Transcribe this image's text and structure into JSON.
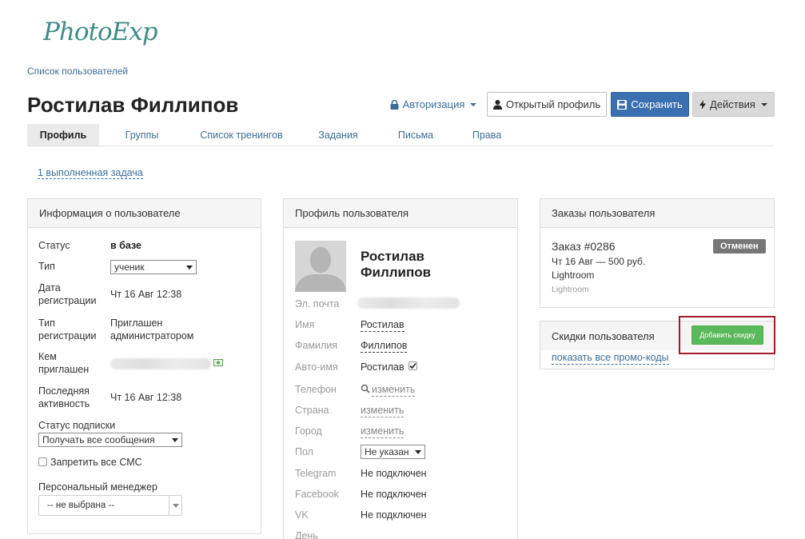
{
  "logo": "PhotoExp",
  "breadcrumb": "Список пользователей",
  "page_title": "Ростилав Филлипов",
  "header_buttons": {
    "auth": "Авторизация",
    "open_profile": "Открытый профиль",
    "save": "Сохранить",
    "actions": "Действия"
  },
  "tabs": [
    "Профиль",
    "Группы",
    "Список тренингов",
    "Задания",
    "Письма",
    "Права"
  ],
  "completed_tasks": "1 выполненная задача",
  "user_info": {
    "title": "Информация о пользователе",
    "status_label": "Статус",
    "status_value": "в базе",
    "type_label": "Тип",
    "type_value": "ученик",
    "reg_date_label_1": "Дата",
    "reg_date_label_2": "регистрации",
    "reg_date_value": "Чт 16 Авг 12:38",
    "reg_type_label_1": "Тип",
    "reg_type_label_2": "регистрации",
    "reg_type_value_1": "Приглашен",
    "reg_type_value_2": "администратором",
    "invited_by_label_1": "Кем",
    "invited_by_label_2": "приглашен",
    "last_activity_label_1": "Последняя",
    "last_activity_label_2": "активность",
    "last_activity_value": "Чт 16 Авг 12:38",
    "subscription_label": "Статус подписки",
    "subscription_value": "Получать все сообщения",
    "block_sms": "Запретить все СМС",
    "manager_label": "Персональный менеджер",
    "manager_value": "-- не выбрана --"
  },
  "profile": {
    "title": "Профиль пользователя",
    "name_line1": "Ростилав",
    "name_line2": "Филлипов",
    "email_label": "Эл. почта",
    "first_name_label": "Имя",
    "first_name_value": "Ростилав",
    "last_name_label": "Фамилия",
    "last_name_value": "Филлипов",
    "auto_name_label": "Авто-имя",
    "auto_name_value": "Ростилав",
    "phone_label": "Телефон",
    "phone_action": "изменить",
    "country_label": "Страна",
    "country_action": "изменить",
    "city_label": "Город",
    "city_action": "изменить",
    "gender_label": "Пол",
    "gender_value": "Не указан",
    "telegram_label": "Telegram",
    "telegram_value": "Не подключен",
    "facebook_label": "Facebook",
    "facebook_value": "Не подключен",
    "vk_label": "VK",
    "vk_value": "Не подключен",
    "day_label": "День"
  },
  "orders": {
    "title": "Заказы пользователя",
    "order_id": "Заказ #0286",
    "order_status": "Отменен",
    "order_line": "Чт 16 Авг — 500 руб.",
    "order_product": "Lightroom",
    "order_product_sub": "Lightroom"
  },
  "discounts": {
    "title": "Скидки пользователя",
    "add_button": "Добавить скидку",
    "show_promo": "показать все промо-коды"
  },
  "colors": {
    "link": "#3a6d99",
    "primary": "#3a6fb0",
    "success": "#5cb85c",
    "highlight": "#a01c2a",
    "badge": "#777777"
  }
}
